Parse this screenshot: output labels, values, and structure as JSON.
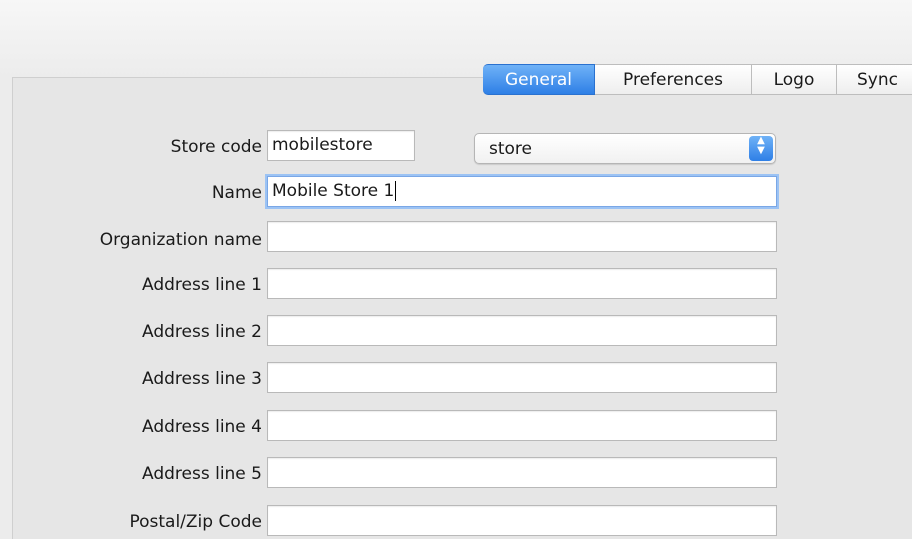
{
  "tabs": [
    "General",
    "Preferences",
    "Logo",
    "Sync"
  ],
  "form": {
    "store_code": {
      "label": "Store code",
      "value": "mobilestore"
    },
    "store_type": {
      "value": "store"
    },
    "name": {
      "label": "Name",
      "value": "Mobile Store 1"
    },
    "organization_name": {
      "label": "Organization name",
      "value": ""
    },
    "address_line_1": {
      "label": "Address line 1",
      "value": ""
    },
    "address_line_2": {
      "label": "Address line 2",
      "value": ""
    },
    "address_line_3": {
      "label": "Address line 3",
      "value": ""
    },
    "address_line_4": {
      "label": "Address line 4",
      "value": ""
    },
    "address_line_5": {
      "label": "Address line 5",
      "value": ""
    },
    "postal_zip_code": {
      "label": "Postal/Zip Code",
      "value": ""
    }
  },
  "icons": {
    "select_arrows": "updown-chevron-icon"
  },
  "colors": {
    "accent": "#3b8ff0",
    "focus_ring": "#9cc3f4"
  }
}
